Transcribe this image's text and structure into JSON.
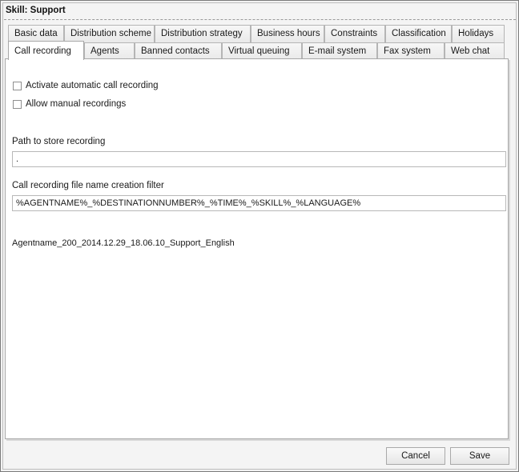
{
  "window": {
    "title": "Skill: Support"
  },
  "tabs_row1": [
    {
      "label": "Basic data"
    },
    {
      "label": "Distribution scheme"
    },
    {
      "label": "Distribution strategy"
    },
    {
      "label": "Business hours"
    },
    {
      "label": "Constraints"
    },
    {
      "label": "Classification"
    },
    {
      "label": "Holidays"
    }
  ],
  "tabs_row2": [
    {
      "label": "Call recording",
      "active": true
    },
    {
      "label": "Agents"
    },
    {
      "label": "Banned contacts"
    },
    {
      "label": "Virtual queuing"
    },
    {
      "label": "E-mail system"
    },
    {
      "label": "Fax system"
    },
    {
      "label": "Web chat"
    }
  ],
  "call_recording": {
    "activate_automatic_label": "Activate automatic call recording",
    "activate_automatic_checked": false,
    "allow_manual_label": "Allow manual recordings",
    "allow_manual_checked": false,
    "path_label": "Path to store recording",
    "path_value": ".",
    "filter_label": "Call recording file name creation filter",
    "filter_value": "%AGENTNAME%_%DESTINATIONNUMBER%_%TIME%_%SKILL%_%LANGUAGE%",
    "preview_text": "Agentname_200_2014.12.29_18.06.10_Support_English"
  },
  "buttons": {
    "cancel_label": "Cancel",
    "save_label": "Save"
  }
}
